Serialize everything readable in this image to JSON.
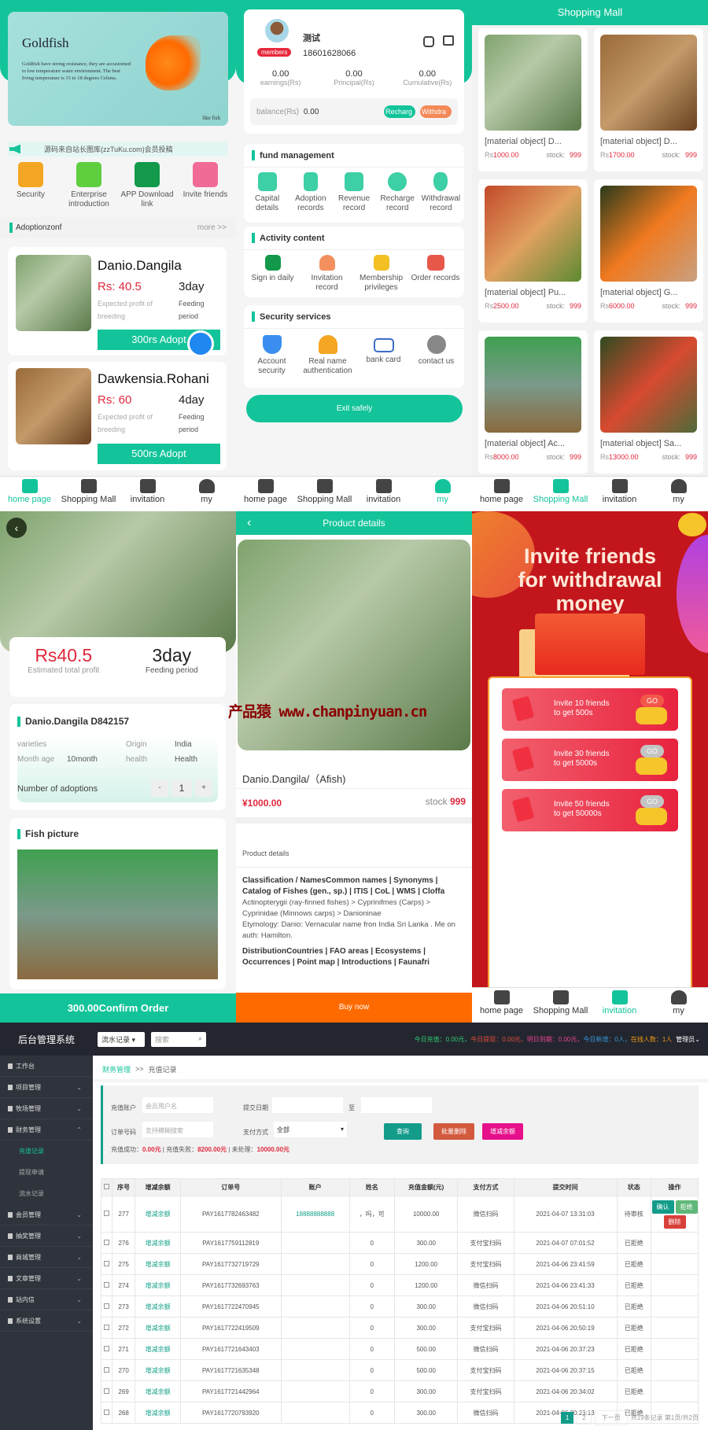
{
  "home": {
    "banner": {
      "title": "Goldfish",
      "text": "Goldfish have strong resistance, they are accustomed to low temperature water environment. The best living temperature is 15 to 18 degrees Celsius.",
      "tag": "like fish"
    },
    "notice": "源码来自站长图库(zzTuKu.com)会员投稿",
    "shortcuts": [
      {
        "label": "Security",
        "color": "#f5a623"
      },
      {
        "label": "Enterprise introduction",
        "color": "#5fcf3f"
      },
      {
        "label": "APP Download link",
        "color": "#129a4a"
      },
      {
        "label": "Invite friends",
        "color": "#f06b96"
      }
    ],
    "section_title": "Adoptionzonf",
    "more": "more >>",
    "products": [
      {
        "name": "Danio.Dangila",
        "profit": "Rs: 40.5",
        "profit_label": "Expected profit of breeding",
        "period": "3day",
        "period_label": "Feeding period",
        "button": "300rs Adopt"
      },
      {
        "name": "Dawkensia.Rohani",
        "profit": "Rs: 60",
        "profit_label": "Expected profit of breeding",
        "period": "4day",
        "period_label": "Feeding period",
        "button": "500rs Adopt"
      }
    ]
  },
  "nav": [
    "home page",
    "Shopping Mall",
    "invitation",
    "my"
  ],
  "my": {
    "name": "测试",
    "badge": "members",
    "phone": "18601628066",
    "stats": [
      {
        "value": "0.00",
        "label": "earnings(Rs)"
      },
      {
        "value": "0.00",
        "label": "Principal(Rs)"
      },
      {
        "value": "0.00",
        "label": "Cumulative(Rs)"
      }
    ],
    "balance_label": "balance(Rs)",
    "balance": "0.00",
    "recharge": "Recharg",
    "withdraw": "Withdra",
    "fund_title": "fund management",
    "fund": [
      "Capital details",
      "Adoption records",
      "Revenue record",
      "Recharge record",
      "Withdrawal record"
    ],
    "activity_title": "Activity content",
    "activity": [
      "Sign in daily",
      "Invitation record",
      "Membership privileges",
      "Order records"
    ],
    "security_title": "Security services",
    "security": [
      "Account security",
      "Real name authentication",
      "bank card",
      "contact us"
    ],
    "exit": "Exit safely"
  },
  "mall": {
    "title": "Shopping Mall",
    "stock_label": "stock:",
    "items": [
      {
        "name": "[material object] D...",
        "price": "1000.00",
        "stock": "999"
      },
      {
        "name": "[material object] D...",
        "price": "1700.00",
        "stock": "999"
      },
      {
        "name": "[material object] Pu...",
        "price": "2500.00",
        "stock": "999"
      },
      {
        "name": "[material object] G...",
        "price": "6000.00",
        "stock": "999"
      },
      {
        "name": "[material object] Ac...",
        "price": "8000.00",
        "stock": "999"
      },
      {
        "name": "[material object] Sa...",
        "price": "13000.00",
        "stock": "999"
      }
    ],
    "currency": "Rs"
  },
  "detail": {
    "profit": "Rs40.5",
    "profit_label": "Estimated total profit",
    "period": "3day",
    "period_label": "Feeding period",
    "title": "Danio.Dangila  D842157",
    "fields": [
      {
        "k": "varieties",
        "v": ""
      },
      {
        "k": "Origin",
        "v": "India"
      },
      {
        "k": "Month age",
        "v": "10month"
      },
      {
        "k": "health",
        "v": "Health"
      }
    ],
    "adopt_label": "Number of adoptions",
    "minus": "-",
    "qty": "1",
    "plus": "+",
    "pic_title": "Fish picture",
    "confirm": "300.00Confirm Order"
  },
  "product": {
    "header": "Product details",
    "name": "Danio.Dangila/（Afish)",
    "price": "¥1000.00",
    "stock_label": "stock",
    "stock": "999",
    "details_label": "Product details",
    "h1": "Classification / NamesCommon names | Synonyms | Catalog of Fishes (gen., sp.) | ITIS | CoL | WMS | Cloffa",
    "p1": "Actinopterygii (ray-finned fishes) > Cyprinifmes (Carps) > Cyprinidae (Minnows  carps) > Danioninae",
    "p2": "Etymology: Danio: Vernacular name fron India  Sri Lanka . Me on auth: Hamilton.",
    "h2": "DistributionCountries | FAO areas | Ecosystems | Occurrences | Point map | Introductions | Faunafri",
    "buy": "Buy now"
  },
  "watermark": "产品猿  www.chanpinyuan.cn",
  "invite": {
    "title_lines": [
      "Invite friends",
      "for withdrawal",
      "money"
    ],
    "rows": [
      {
        "line1": "Invite 10 friends",
        "line2": "to get 500s",
        "go": "GO",
        "active": true
      },
      {
        "line1": "Invite 30 friends",
        "line2": "to get 5000s",
        "go": "GO",
        "active": false
      },
      {
        "line1": "Invite 50 friends",
        "line2": "to get 50000s",
        "go": "GO",
        "active": false
      }
    ]
  },
  "admin": {
    "brand": "后台管理系统",
    "select": "流水记录",
    "search_placeholder": "搜索",
    "stats": [
      {
        "text": "今日充值：0.00元，",
        "color": "#2ecc71"
      },
      {
        "text": "今日提现：0.00元，",
        "color": "#e74c3c"
      },
      {
        "text": "明日到期：0.00元，",
        "color": "#e84393"
      },
      {
        "text": "今日新增：0人，",
        "color": "#3498db"
      },
      {
        "text": "在线人数：1人",
        "color": "#f39c12"
      }
    ],
    "user": "管理员",
    "sidebar": [
      {
        "label": "工作台"
      },
      {
        "label": "项目管理",
        "chev": "⌄"
      },
      {
        "label": "牧场管理",
        "chev": "⌄"
      },
      {
        "label": "财务管理",
        "chev": "⌃",
        "children": [
          "充值记录",
          "提现申请",
          "流水记录"
        ]
      },
      {
        "label": "会员管理",
        "chev": "⌄"
      },
      {
        "label": "抽奖管理",
        "chev": "⌄"
      },
      {
        "label": "商城管理",
        "chev": "⌄"
      },
      {
        "label": "文章管理",
        "chev": "⌄"
      },
      {
        "label": "站内信",
        "chev": "⌄"
      },
      {
        "label": "系统设置",
        "chev": "⌄"
      }
    ],
    "breadcrumb": [
      "财务管理",
      ">>",
      "充值记录"
    ],
    "filters": {
      "account_label": "充值账户",
      "account_placeholder": "会员用户名",
      "date_label": "提交日期",
      "to": "至",
      "order_label": "订单号码",
      "order_placeholder": "支持模糊搜索",
      "pay_label": "支付方式",
      "pay_value": "全部",
      "query": "查询",
      "batch_delete": "批量删除",
      "adjust": "增减余额"
    },
    "summary": [
      {
        "k": "充值成功：",
        "v": "0.00元"
      },
      {
        "k": "充值失败：",
        "v": "8200.00元"
      },
      {
        "k": "未处理：",
        "v": "10000.00元"
      }
    ],
    "columns": [
      "",
      "序号",
      "增减余额",
      "订单号",
      "账户",
      "姓名",
      "充值金额(元)",
      "支付方式",
      "提交时间",
      "状态",
      "操作"
    ],
    "rows": [
      [
        "277",
        "增减余额",
        "PAY1617782463482",
        "18888888888",
        "，吗，可",
        "10000.00",
        "微信扫码",
        "2021-04-07 13:31:03",
        "待审核"
      ],
      [
        "276",
        "增减余额",
        "PAY1617759112819",
        "",
        "0",
        "300.00",
        "支付宝扫码",
        "2021-04-07 07:01:52",
        "已拒绝"
      ],
      [
        "275",
        "增减余额",
        "PAY1617732719729",
        "",
        "0",
        "1200.00",
        "支付宝扫码",
        "2021-04-06 23:41:59",
        "已拒绝"
      ],
      [
        "274",
        "增减余额",
        "PAY1617732693763",
        "",
        "0",
        "1200.00",
        "微信扫码",
        "2021-04-06 23:41:33",
        "已拒绝"
      ],
      [
        "273",
        "增减余额",
        "PAY1617722470945",
        "",
        "0",
        "300.00",
        "微信扫码",
        "2021-04-06 20:51:10",
        "已拒绝"
      ],
      [
        "272",
        "增减余额",
        "PAY1617722419509",
        "",
        "0",
        "300.00",
        "支付宝扫码",
        "2021-04-06 20:50:19",
        "已拒绝"
      ],
      [
        "271",
        "增减余额",
        "PAY1617721643403",
        "",
        "0",
        "500.00",
        "微信扫码",
        "2021-04-06 20:37:23",
        "已拒绝"
      ],
      [
        "270",
        "增减余额",
        "PAY1617721635348",
        "",
        "0",
        "500.00",
        "支付宝扫码",
        "2021-04-06 20:37:15",
        "已拒绝"
      ],
      [
        "269",
        "增减余额",
        "PAY1617721442964",
        "",
        "0",
        "300.00",
        "支付宝扫码",
        "2021-04-06 20:34:02",
        "已拒绝"
      ],
      [
        "268",
        "增减余额",
        "PAY1617720793920",
        "",
        "0",
        "300.00",
        "微信扫码",
        "2021-04-06 20:23:13",
        "已拒绝"
      ]
    ],
    "actions": {
      "confirm": "确认",
      "reject": "拒绝",
      "delete": "删除"
    },
    "pagination": {
      "pages": [
        "1",
        "2"
      ],
      "next": "下一页",
      "info": "共19条记录 第1页/共2页"
    }
  },
  "colors": {
    "accent": "#13c49a",
    "price": "#e0283c",
    "orange": "#ff6a00",
    "admin_dark": "#23262e"
  }
}
